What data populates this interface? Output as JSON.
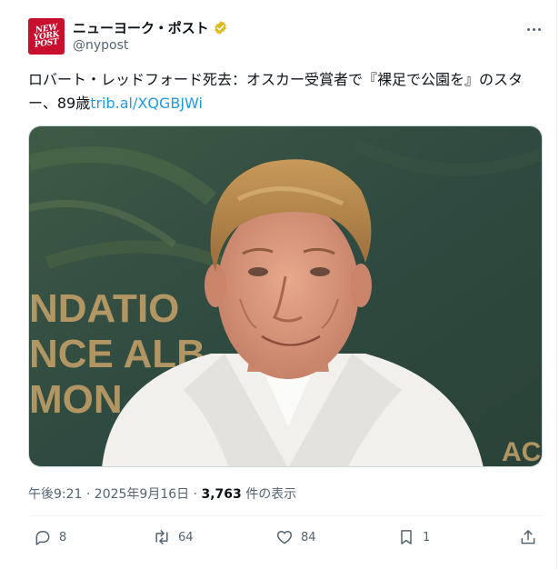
{
  "account": {
    "name": "ニューヨーク・ポスト",
    "handle": "@nypost",
    "avatar_lines": [
      "NEW",
      "YORK",
      "POST"
    ]
  },
  "tweet": {
    "text": "ロバート・レッドフォード死去：オスカー受賞者で『裸足で公園を』のスター、89歳",
    "link": "trib.al/XQGBJWi"
  },
  "image": {
    "background_text": [
      "NDATIO",
      "NCE ALB",
      "MON",
      "AC"
    ]
  },
  "meta": {
    "timestamp": "午後9:21 · 2025年9月16日 · ",
    "views": "3,763",
    "views_suffix": " 件の表示"
  },
  "actions": {
    "replies": "8",
    "reposts": "64",
    "likes": "84",
    "bookmarks": "1"
  },
  "colors": {
    "accent": "#1d9bf0",
    "brand": "#c8102e",
    "verified": "#e2b719"
  },
  "icons": [
    "verified-badge-icon",
    "more-icon",
    "reply-icon",
    "repost-icon",
    "like-icon",
    "bookmark-icon",
    "share-icon"
  ]
}
